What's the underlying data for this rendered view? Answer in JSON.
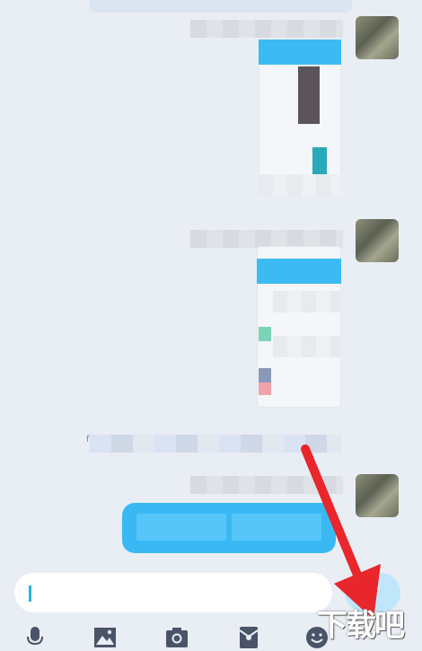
{
  "chat": {
    "system_note_prefix": "f"
  },
  "composer": {
    "input_value": "",
    "send_icon": "send-icon"
  },
  "toolbar": {
    "items": [
      {
        "icon": "microphone-icon"
      },
      {
        "icon": "image-icon"
      },
      {
        "icon": "camera-icon"
      },
      {
        "icon": "red-packet-icon"
      },
      {
        "icon": "emoji-icon"
      }
    ]
  },
  "watermark": {
    "text": "下载吧"
  },
  "colors": {
    "accent": "#3ab8f4",
    "arrow": "#e8262b",
    "background": "#e9edf4"
  }
}
